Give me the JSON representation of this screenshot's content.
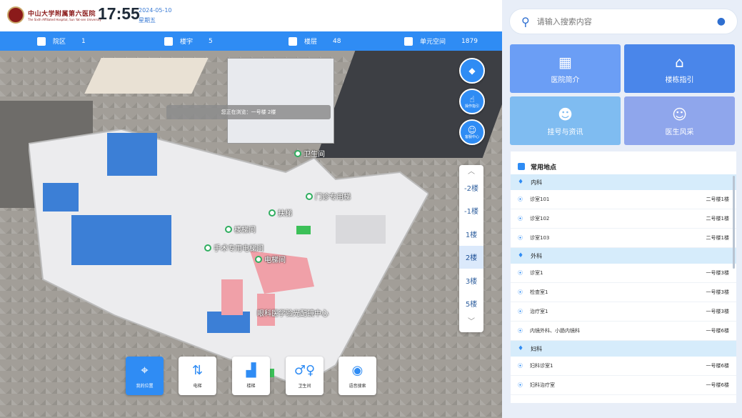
{
  "header": {
    "hospital_name": "中山大学附属第六医院",
    "hospital_sub": "The Sixth Affiliated Hospital, Sun Yat-sen University",
    "time": "17:55",
    "date": "2024-05-10",
    "weekday": "星期五"
  },
  "stats": [
    {
      "icon": "campus-icon",
      "label": "院区",
      "value": "1"
    },
    {
      "icon": "building-icon",
      "label": "楼宇",
      "value": "5"
    },
    {
      "icon": "floor-icon",
      "label": "楼层",
      "value": "48"
    },
    {
      "icon": "room-icon",
      "label": "单元空间",
      "value": "1879"
    }
  ],
  "map": {
    "notice": "您正在浏览：一号楼 2楼",
    "controls": [
      {
        "name": "compass-button",
        "label": "",
        "glyph": "◆"
      },
      {
        "name": "guide-button",
        "label": "操作指引",
        "glyph": "☝"
      },
      {
        "name": "service-button",
        "label": "客服中心",
        "glyph": "☺"
      }
    ],
    "floors": [
      "-2楼",
      "-1楼",
      "1楼",
      "2楼",
      "3楼",
      "5楼"
    ],
    "selected_floor": "2楼",
    "pois": [
      {
        "text": "卫生间"
      },
      {
        "text": "门诊专用梯"
      },
      {
        "text": "扶梯"
      },
      {
        "text": "楼梯间"
      },
      {
        "text": "手术专用电梯间"
      },
      {
        "text": "电梯间"
      },
      {
        "text": "眼科医学验光配镜中心"
      }
    ],
    "tools": [
      {
        "label": "我的位置",
        "glyph": "⌖",
        "active": true
      },
      {
        "label": "电梯",
        "glyph": "⇅"
      },
      {
        "label": "楼梯",
        "glyph": "▟"
      },
      {
        "label": "卫生间",
        "glyph": "♂♀"
      },
      {
        "label": "语音搜索",
        "glyph": "🎤"
      }
    ]
  },
  "sidebar": {
    "search_placeholder": "请输入搜索内容",
    "cards": [
      {
        "label": "医院简介",
        "glyph": "▦",
        "color": "#6b9ef5"
      },
      {
        "label": "楼栋指引",
        "glyph": "⌂",
        "color": "#4a86ea"
      },
      {
        "label": "挂号与资讯",
        "glyph": "☻",
        "color": "#7fbcf1"
      },
      {
        "label": "医生风采",
        "glyph": "☺",
        "color": "#8fa6ec"
      }
    ],
    "common_places_title": "常用地点",
    "categories": [
      {
        "name": "内科",
        "items": [
          {
            "name": "诊室101",
            "loc": "二号楼1楼"
          },
          {
            "name": "诊室102",
            "loc": "二号楼1楼"
          },
          {
            "name": "诊室103",
            "loc": "二号楼1楼"
          }
        ]
      },
      {
        "name": "外科",
        "items": [
          {
            "name": "诊室1",
            "loc": "一号楼3楼"
          },
          {
            "name": "检查室1",
            "loc": "一号楼3楼"
          },
          {
            "name": "治疗室1",
            "loc": "一号楼3楼"
          },
          {
            "name": "内镜外科、小肠内镜科",
            "loc": "一号楼6楼"
          }
        ]
      },
      {
        "name": "妇科",
        "items": [
          {
            "name": "妇科诊室1",
            "loc": "一号楼6楼"
          },
          {
            "name": "妇科治疗室",
            "loc": "一号楼6楼"
          }
        ]
      }
    ]
  }
}
